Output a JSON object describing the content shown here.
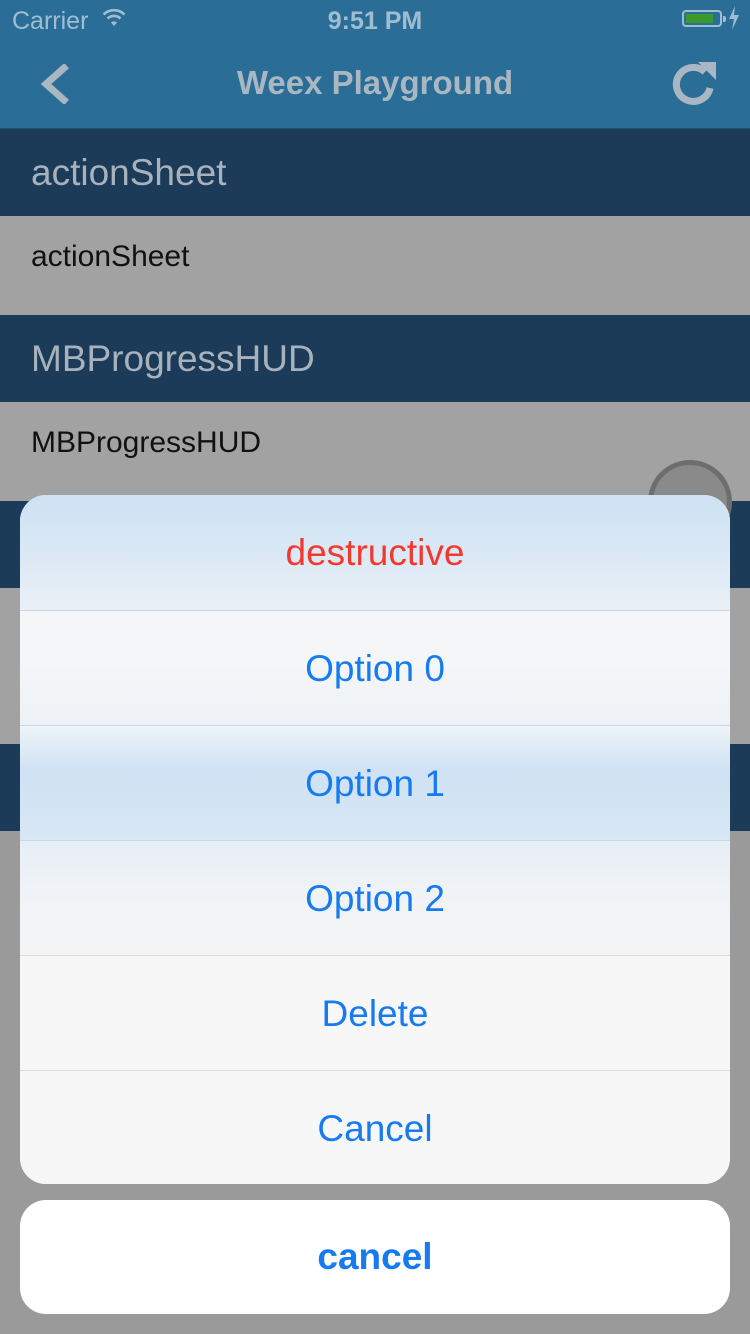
{
  "status_bar": {
    "carrier": "Carrier",
    "time": "9:51 PM",
    "battery_level": 0.85
  },
  "nav": {
    "title": "Weex Playground",
    "back_icon": "chevron-left-icon",
    "refresh_icon": "refresh-icon"
  },
  "list": {
    "sections": [
      {
        "header": "actionSheet",
        "item": "actionSheet"
      },
      {
        "header": "MBProgressHUD",
        "item": "MBProgressHUD"
      }
    ]
  },
  "action_sheet": {
    "destructive_label": "destructive",
    "options": [
      "Option 0",
      "Option 1",
      "Option 2",
      "Delete",
      "Cancel"
    ],
    "cancel_label": "cancel"
  },
  "colors": {
    "action_blue": "#167bf0",
    "destructive_red": "#f2392f",
    "nav_blue": "#2a6e98",
    "section_header": "#1b3b59"
  }
}
